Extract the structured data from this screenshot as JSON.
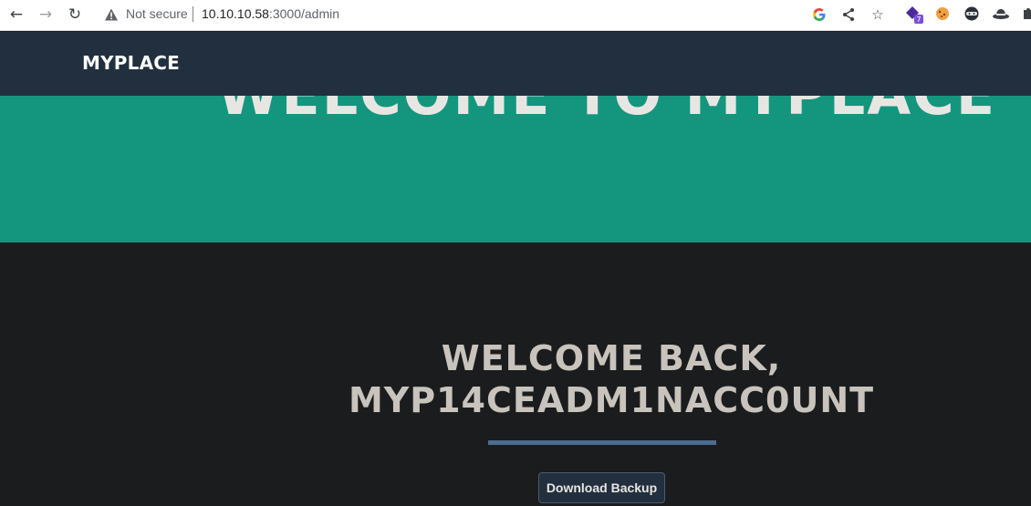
{
  "browser": {
    "security_label": "Not secure",
    "url_host": "10.10.10.58",
    "url_rest": ":3000/admin",
    "extension_badge": "7"
  },
  "site": {
    "brand": "MYPLACE",
    "hero_title": "WELCOME TO MYPLACE",
    "welcome_line1": "WELCOME BACK,",
    "welcome_line2": "MYP14CEADM1NACC0UNT",
    "download_button": "Download Backup"
  },
  "colors": {
    "header_bg": "#222f3e",
    "hero_bg": "#14967e",
    "main_bg": "#1b1c1e",
    "divider": "#4b6d8f"
  }
}
